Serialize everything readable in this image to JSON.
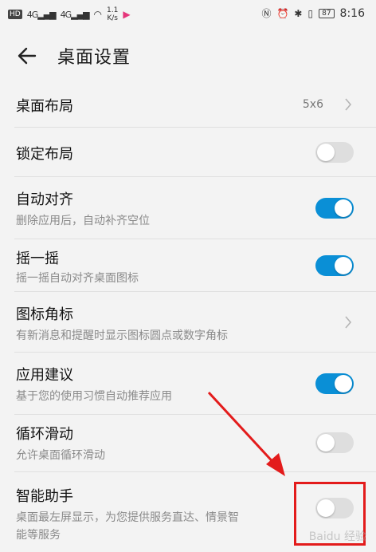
{
  "status_bar": {
    "left_badge": "HD",
    "signal_1": "4G",
    "signal_2": "4G",
    "speed_top": "1.1",
    "speed_unit": "K/s",
    "battery": "87",
    "time": "8:16"
  },
  "header": {
    "title": "桌面设置"
  },
  "settings": [
    {
      "title": "桌面布局",
      "value": "5x6",
      "control": "chevron"
    },
    {
      "title": "锁定布局",
      "control": "toggle",
      "on": false
    },
    {
      "title": "自动对齐",
      "subtitle": "删除应用后，自动补齐空位",
      "control": "toggle",
      "on": true
    },
    {
      "title": "摇一摇",
      "subtitle": "摇一摇自动对齐桌面图标",
      "control": "toggle",
      "on": true
    },
    {
      "title": "图标角标",
      "subtitle": "有新消息和提醒时显示图标圆点或数字角标",
      "control": "chevron"
    },
    {
      "title": "应用建议",
      "subtitle": "基于您的使用习惯自动推荐应用",
      "control": "toggle",
      "on": true
    },
    {
      "title": "循环滑动",
      "subtitle": "允许桌面循环滑动",
      "control": "toggle",
      "on": false
    },
    {
      "title": "智能助手",
      "subtitle_line1": "桌面最左屏显示，为您提供服务直达、情景智",
      "subtitle_line2": "能等服务",
      "control": "toggle",
      "on": false
    }
  ],
  "watermark": "Baidu 经验",
  "colors": {
    "accent": "#0a8fd6",
    "toggle_off": "#dedede",
    "annotation": "#e31b1b"
  }
}
